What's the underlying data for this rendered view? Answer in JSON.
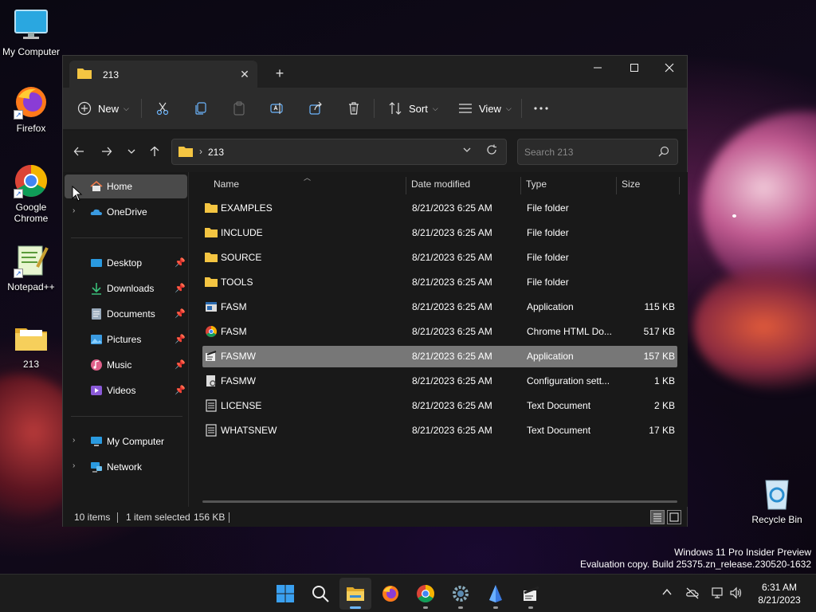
{
  "desktop": {
    "icons": [
      {
        "label": "My Computer",
        "icon": "monitor-icon"
      },
      {
        "label": "Firefox",
        "icon": "firefox-icon"
      },
      {
        "label": "Google Chrome",
        "icon": "chrome-icon"
      },
      {
        "label": "Notepad++",
        "icon": "notepadpp-icon"
      },
      {
        "label": "213",
        "icon": "folder-icon"
      },
      {
        "label": "Recycle Bin",
        "icon": "recycle-bin-icon"
      }
    ]
  },
  "window": {
    "tab_title": "213",
    "commands": {
      "new_label": "New",
      "sort_label": "Sort",
      "view_label": "View"
    },
    "address": {
      "path": "213"
    },
    "search": {
      "placeholder": "Search 213"
    },
    "nav": {
      "items": [
        {
          "label": "Home",
          "icon": "home-icon",
          "selected": true
        },
        {
          "label": "OneDrive",
          "icon": "cloud-icon",
          "expandable": true
        },
        {
          "label": "Desktop",
          "icon": "desktop-icon",
          "pinned": true
        },
        {
          "label": "Downloads",
          "icon": "download-icon",
          "pinned": true
        },
        {
          "label": "Documents",
          "icon": "documents-icon",
          "pinned": true
        },
        {
          "label": "Pictures",
          "icon": "pictures-icon",
          "pinned": true
        },
        {
          "label": "Music",
          "icon": "music-icon",
          "pinned": true
        },
        {
          "label": "Videos",
          "icon": "videos-icon",
          "pinned": true
        },
        {
          "label": "My Computer",
          "icon": "computer-icon",
          "expandable": true
        },
        {
          "label": "Network",
          "icon": "network-icon",
          "expandable": true
        }
      ]
    },
    "columns": [
      "Name",
      "Date modified",
      "Type",
      "Size"
    ],
    "files": [
      {
        "name": "EXAMPLES",
        "date": "8/21/2023 6:25 AM",
        "type": "File folder",
        "size": "",
        "icon": "folder-icon"
      },
      {
        "name": "INCLUDE",
        "date": "8/21/2023 6:25 AM",
        "type": "File folder",
        "size": "",
        "icon": "folder-icon"
      },
      {
        "name": "SOURCE",
        "date": "8/21/2023 6:25 AM",
        "type": "File folder",
        "size": "",
        "icon": "folder-icon"
      },
      {
        "name": "TOOLS",
        "date": "8/21/2023 6:25 AM",
        "type": "File folder",
        "size": "",
        "icon": "folder-icon"
      },
      {
        "name": "FASM",
        "date": "8/21/2023 6:25 AM",
        "type": "Application",
        "size": "115 KB",
        "icon": "app-icon"
      },
      {
        "name": "FASM",
        "date": "8/21/2023 6:25 AM",
        "type": "Chrome HTML Do...",
        "size": "517 KB",
        "icon": "chrome-icon"
      },
      {
        "name": "FASMW",
        "date": "8/21/2023 6:25 AM",
        "type": "Application",
        "size": "157 KB",
        "icon": "fasmw-icon",
        "selected": true
      },
      {
        "name": "FASMW",
        "date": "8/21/2023 6:25 AM",
        "type": "Configuration sett...",
        "size": "1 KB",
        "icon": "config-icon"
      },
      {
        "name": "LICENSE",
        "date": "8/21/2023 6:25 AM",
        "type": "Text Document",
        "size": "2 KB",
        "icon": "text-doc-icon"
      },
      {
        "name": "WHATSNEW",
        "date": "8/21/2023 6:25 AM",
        "type": "Text Document",
        "size": "17 KB",
        "icon": "text-doc-icon"
      }
    ],
    "status": {
      "items": "10 items",
      "selected": "1 item selected",
      "size": "156 KB"
    }
  },
  "watermark": {
    "line1": "Windows 11 Pro Insider Preview",
    "line2": "Evaluation copy. Build 25375.zn_release.230520-1632"
  },
  "taskbar": {
    "time": "6:31 AM",
    "date": "8/21/2023"
  },
  "colors": {
    "accent": "#6cb6ff",
    "folder": "#f4c542",
    "selection": "#777777"
  }
}
